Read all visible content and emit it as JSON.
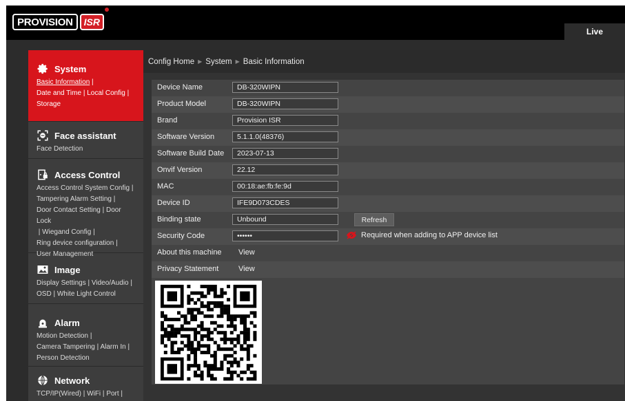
{
  "header": {
    "logo_text": "PROVISION",
    "logo_badge": "ISR",
    "live_tab": "Live"
  },
  "sidebar": {
    "system": {
      "title": "System",
      "icon": "gear-icon",
      "links": [
        "Basic Information",
        "Date and Time",
        "Local Config",
        "Storage"
      ]
    },
    "face": {
      "title": "Face assistant",
      "icon": "face-scan-icon",
      "links": [
        "Face Detection"
      ]
    },
    "access": {
      "title": "Access Control",
      "icon": "access-door-icon",
      "links": [
        "Access Control System Config",
        "Tampering Alarm Setting",
        "Door Contact Setting",
        "Door Lock",
        "Wiegand Config",
        "Ring device configuration",
        "User Management"
      ]
    },
    "image": {
      "title": "Image",
      "icon": "image-icon",
      "links": [
        "Display Settings",
        "Video/Audio",
        "OSD",
        "White Light Control"
      ]
    },
    "alarm": {
      "title": "Alarm",
      "icon": "alarm-icon",
      "links": [
        "Motion Detection",
        "Camera Tampering",
        "Alarm In",
        "Person Detection"
      ]
    },
    "network": {
      "title": "Network",
      "icon": "globe-icon",
      "links": [
        "TCP/IP(Wired)",
        "WiFi",
        "Port"
      ]
    }
  },
  "breadcrumb": [
    "Config Home",
    "System",
    "Basic Information"
  ],
  "info": {
    "device_name": {
      "label": "Device Name",
      "value": "DB-320WIPN"
    },
    "product_model": {
      "label": "Product Model",
      "value": "DB-320WIPN"
    },
    "brand": {
      "label": "Brand",
      "value": "Provision ISR"
    },
    "software_version": {
      "label": "Software Version",
      "value": "5.1.1.0(48376)"
    },
    "build_date": {
      "label": "Software Build Date",
      "value": "2023-07-13"
    },
    "onvif_version": {
      "label": "Onvif Version",
      "value": "22.12"
    },
    "mac": {
      "label": "MAC",
      "value": "00:18:ae:fb:fe:9d"
    },
    "device_id": {
      "label": "Device ID",
      "value": "IFE9D073CDES"
    },
    "binding_state": {
      "label": "Binding state",
      "value": "Unbound",
      "button": "Refresh"
    },
    "security_code": {
      "label": "Security Code",
      "value": "••••••",
      "hint": "Required when adding to APP device list"
    },
    "about": {
      "label": "About this machine",
      "link": "View"
    },
    "privacy": {
      "label": "Privacy Statement",
      "link": "View"
    }
  },
  "colors": {
    "accent": "#d7151c",
    "background": "#2c2c2c",
    "sidebar": "#3d3d3d",
    "panel": "#444444"
  }
}
